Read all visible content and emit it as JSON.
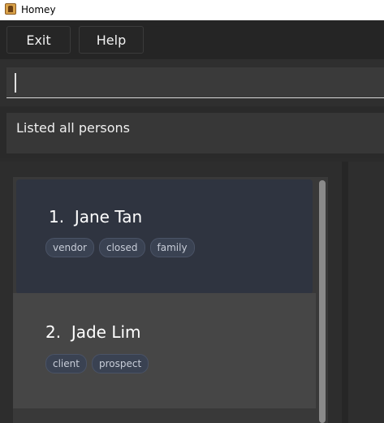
{
  "window": {
    "title": "Homey"
  },
  "menu": {
    "exit_label": "Exit",
    "help_label": "Help"
  },
  "command": {
    "value": ""
  },
  "result": {
    "message": "Listed all persons"
  },
  "persons": [
    {
      "index": "1.",
      "name": "Jane Tan",
      "tags": [
        "vendor",
        "closed",
        "family"
      ]
    },
    {
      "index": "2.",
      "name": "Jade Lim",
      "tags": [
        "client",
        "prospect"
      ]
    }
  ],
  "colors": {
    "tag_bg": "#3a4252",
    "selected_card": "#2f3440",
    "card": "#464646"
  }
}
